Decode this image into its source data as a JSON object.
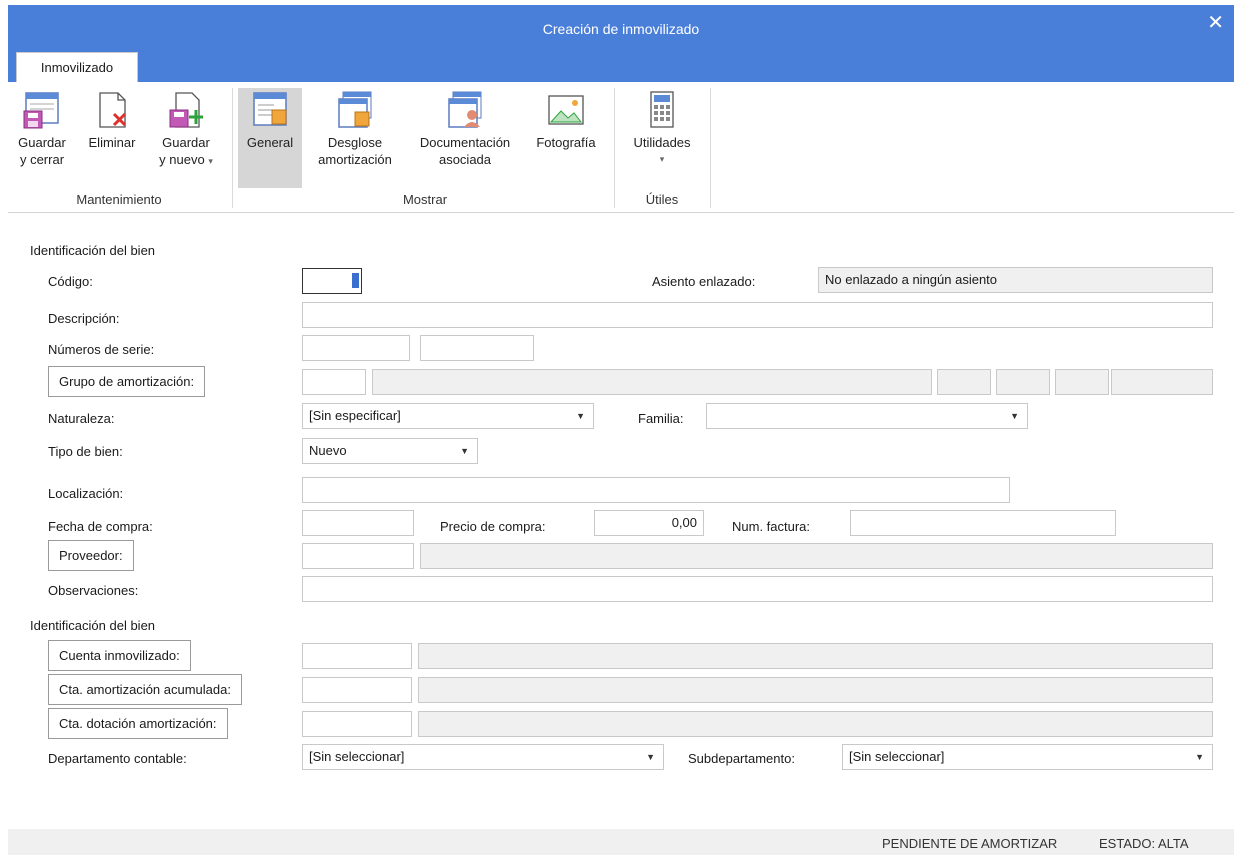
{
  "window": {
    "title": "Creación de inmovilizado",
    "close_glyph": "✕"
  },
  "ribbon": {
    "tab": "Inmovilizado",
    "buttons": {
      "guardar_cerrar": [
        "Guardar",
        "y cerrar"
      ],
      "eliminar": "Eliminar",
      "guardar_nuevo": [
        "Guardar",
        "y nuevo"
      ],
      "general": "General",
      "desglose": [
        "Desglose",
        "amortización"
      ],
      "documentacion": [
        "Documentación",
        "asociada"
      ],
      "fotografia": "Fotografía",
      "utilidades": "Utilidades"
    },
    "groups": {
      "mantenimiento": "Mantenimiento",
      "mostrar": "Mostrar",
      "utiles": "Útiles"
    },
    "dropdown_glyph": "▾"
  },
  "form": {
    "section1": "Identificación del bien",
    "codigo_label": "Código:",
    "codigo_value": "",
    "asiento_label": "Asiento enlazado:",
    "asiento_value": "No enlazado a ningún asiento",
    "descripcion_label": "Descripción:",
    "numeros_serie_label": "Números de serie:",
    "grupo_amort_button": "Grupo de amortización:",
    "naturaleza_label": "Naturaleza:",
    "naturaleza_value": "[Sin especificar]",
    "familia_label": "Familia:",
    "familia_value": "",
    "tipo_bien_label": "Tipo de bien:",
    "tipo_bien_value": "Nuevo",
    "localizacion_label": "Localización:",
    "fecha_compra_label": "Fecha de compra:",
    "precio_compra_label": "Precio de compra:",
    "precio_compra_value": "0,00",
    "num_factura_label": "Num. factura:",
    "proveedor_button": "Proveedor:",
    "observaciones_label": "Observaciones:",
    "section2": "Identificación del bien",
    "cuenta_inmov_button": "Cuenta inmovilizado:",
    "cta_amort_acum_button": "Cta. amortización acumulada:",
    "cta_dotacion_button": "Cta. dotación amortización:",
    "departamento_label": "Departamento contable:",
    "departamento_value": "[Sin seleccionar]",
    "subdepartamento_label": "Subdepartamento:",
    "subdepartamento_value": "[Sin seleccionar]",
    "select_glyph": "▼"
  },
  "status": {
    "pendiente": "PENDIENTE DE AMORTIZAR",
    "estado": "ESTADO: ALTA"
  }
}
